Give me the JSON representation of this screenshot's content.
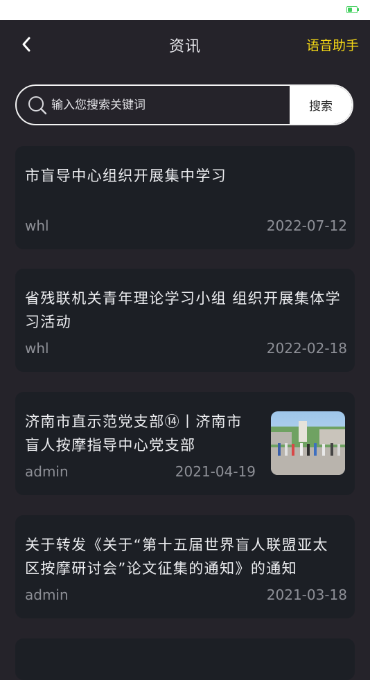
{
  "header": {
    "title": "资讯",
    "assistant_label": "语音助手"
  },
  "search": {
    "placeholder": "输入您搜索关键词",
    "button_label": "搜索"
  },
  "colors": {
    "accent": "#f3d616",
    "background": "#25232a",
    "card": "#1c1f25",
    "battery": "#3ecf5a"
  },
  "icons": {
    "back": "chevron-left-icon",
    "search": "search-icon",
    "battery": "battery-icon"
  },
  "articles": [
    {
      "title": "市盲导中心组织开展集中学习",
      "author": "whl",
      "date": "2022-07-12"
    },
    {
      "title": "省残联机关青年理论学习小组 组织开展集体学习活动",
      "author": "whl",
      "date": "2022-02-18"
    },
    {
      "title": "济南市直示范党支部⑭丨济南市盲人按摩指导中心党支部",
      "author": "admin",
      "date": "2021-04-19",
      "has_image": true
    },
    {
      "title": "关于转发《关于“第十五届世界盲人联盟亚太区按摩研讨会”论文征集的通知》的通知",
      "author": "admin",
      "date": "2021-03-18"
    }
  ]
}
